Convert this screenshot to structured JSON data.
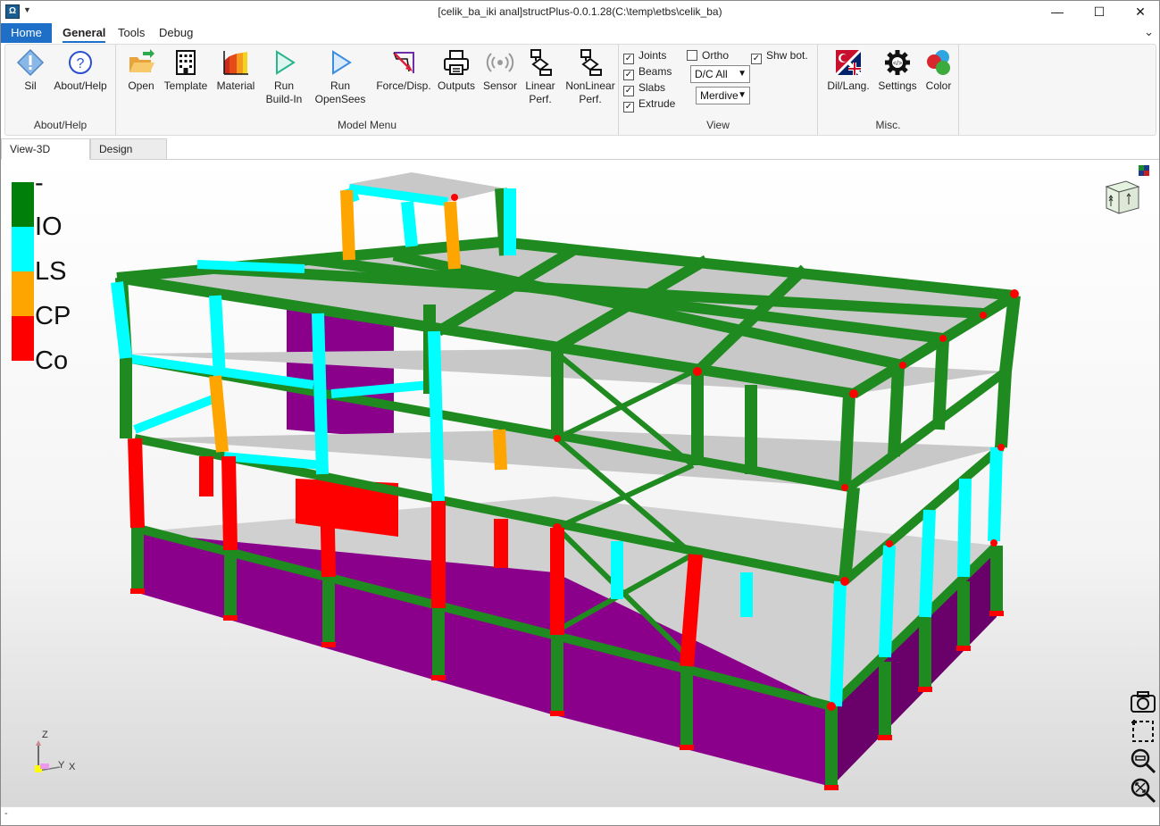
{
  "window": {
    "title": "[celik_ba_iki anal]structPlus-0.0.1.28(C:\\temp\\etbs\\celik_ba)",
    "app_icon": "Ω",
    "minimize": "—",
    "maximize": "☐",
    "close": "✕"
  },
  "menu": {
    "tabs": [
      {
        "label": "Home"
      },
      {
        "label": "General"
      },
      {
        "label": "Tools"
      },
      {
        "label": "Debug"
      }
    ],
    "collapse": "⌄"
  },
  "ribbon": {
    "groups": [
      {
        "label": "About/Help"
      },
      {
        "label": "Model Menu"
      },
      {
        "label": "View"
      },
      {
        "label": "Misc."
      }
    ],
    "buttons": {
      "sil": "Sil",
      "about": "About/Help",
      "open": "Open",
      "template": "Template",
      "material": "Material",
      "run_buildin_1": "Run",
      "run_buildin_2": "Build-In",
      "run_opensees_1": "Run",
      "run_opensees_2": "OpenSees",
      "force_disp": "Force/Disp.",
      "outputs": "Outputs",
      "sensor": "Sensor",
      "linear_1": "Linear",
      "linear_2": "Perf.",
      "nonlinear_1": "NonLinear",
      "nonlinear_2": "Perf.",
      "dil": "Dil/Lang.",
      "settings": "Settings",
      "color": "Color"
    },
    "view": {
      "joints": {
        "label": "Joints",
        "checked": true
      },
      "beams": {
        "label": "Beams",
        "checked": true
      },
      "slabs": {
        "label": "Slabs",
        "checked": true
      },
      "extrude": {
        "label": "Extrude",
        "checked": true
      },
      "ortho": {
        "label": "Ortho",
        "checked": false
      },
      "shw_bot": {
        "label": "Shw bot.",
        "checked": true
      },
      "dc_select": "D/C All",
      "merdiven_select": "Merdive"
    }
  },
  "doc_tabs": [
    {
      "label": "View-3D",
      "active": true
    },
    {
      "label": "Design",
      "active": false
    }
  ],
  "legend": [
    {
      "label": "-",
      "color": "#00800a"
    },
    {
      "label": "IO",
      "color": "#00ffff"
    },
    {
      "label": "LS",
      "color": "#ffa500"
    },
    {
      "label": "CP",
      "color": "#ff0000"
    },
    {
      "label": "Co",
      "color": ""
    }
  ],
  "axis_labels": {
    "z": "Z",
    "y": "Y",
    "x": "X"
  },
  "status": {
    "text": "-"
  },
  "colors": {
    "accent": "#1e6fc7",
    "beam_green": "#1f8a1f",
    "io_cyan": "#00ffff",
    "ls_orange": "#ffa500",
    "cp_red": "#ff0000",
    "wall_purple": "#8b008b",
    "slab_gray": "#c8c8c8"
  },
  "tool_icons": [
    "camera-icon",
    "zoom-window-icon",
    "zoom-out-icon",
    "zoom-extents-icon"
  ]
}
